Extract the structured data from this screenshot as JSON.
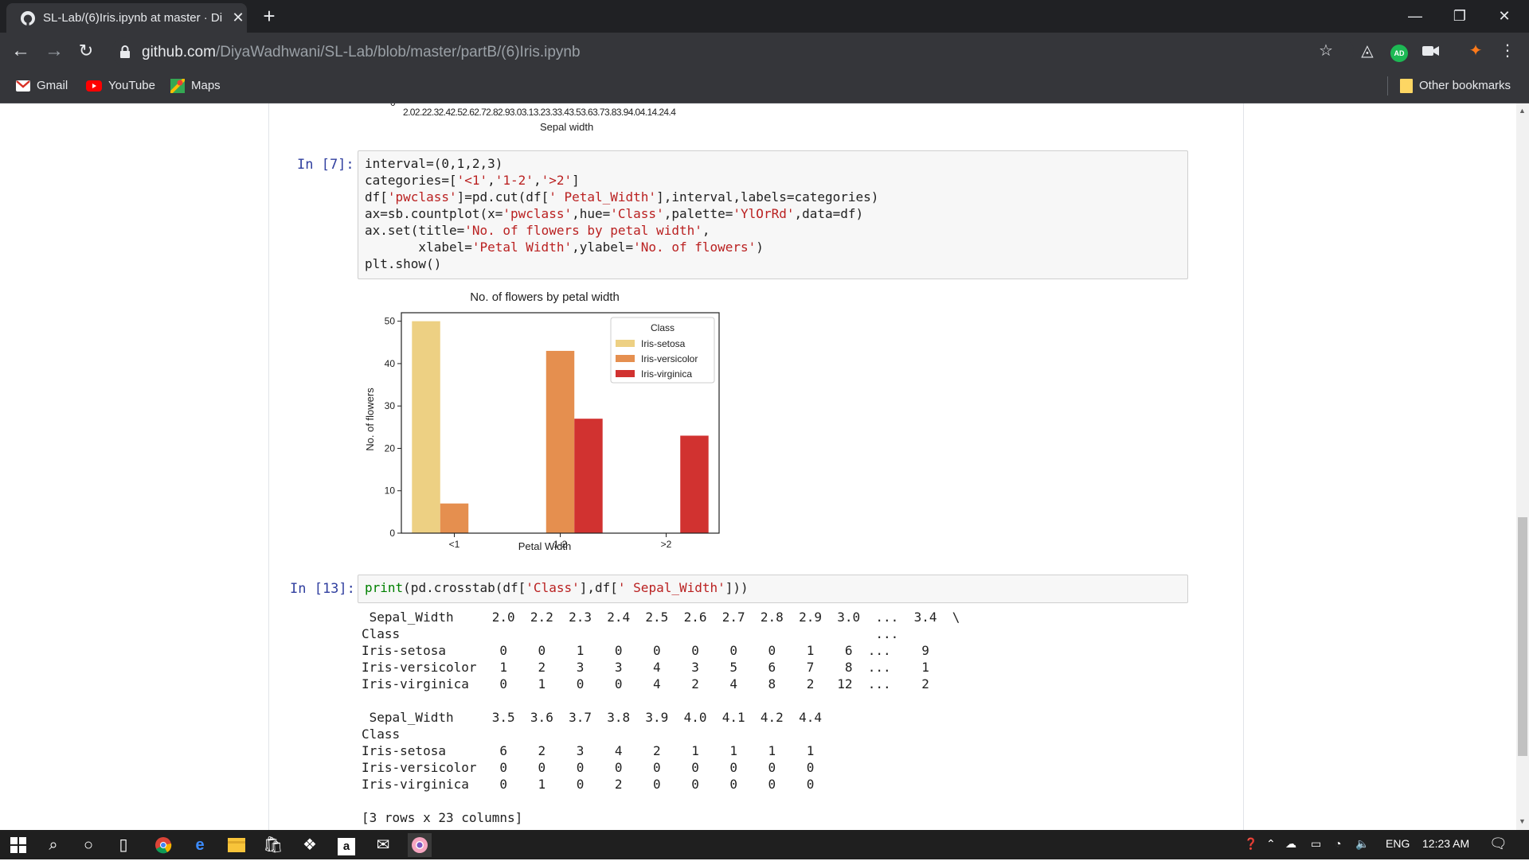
{
  "browser": {
    "tab_title": "SL-Lab/(6)Iris.ipynb at master · Di",
    "url_host": "github.com",
    "url_path": "/DiyaWadhwani/SL-Lab/blob/master/partB/(6)Iris.ipynb",
    "profile_badge": "AD",
    "bookmarks": [
      {
        "label": "Gmail",
        "icon": "gmail-icon"
      },
      {
        "label": "YouTube",
        "icon": "youtube-icon"
      },
      {
        "label": "Maps",
        "icon": "maps-icon"
      }
    ],
    "other_bookmarks": "Other bookmarks"
  },
  "prev_chart": {
    "tick_zero": "0",
    "xticks": "2.02.22.32.42.52.62.72.82.93.03.13.23.33.43.53.63.73.83.94.04.14.24.4",
    "xlabel": "Sepal width"
  },
  "cell7": {
    "prompt": "In [7]:",
    "lines": [
      "interval=(0,1,2,3)",
      "categories=['<1','1-2','>2']",
      "df['pwclass']=pd.cut(df[' Petal_Width'],interval,labels=categories)",
      "ax=sb.countplot(x='pwclass',hue='Class',palette='YlOrRd',data=df)",
      "ax.set(title='No. of flowers by petal width',",
      "       xlabel='Petal Width',ylabel='No. of flowers')",
      "plt.show()"
    ]
  },
  "chart_data": {
    "type": "bar",
    "title": "No. of flowers by petal width",
    "xlabel": "Petal Width",
    "ylabel": "No. of flowers",
    "categories": [
      "<1",
      "1-2",
      ">2"
    ],
    "ylim": [
      0,
      52
    ],
    "yticks": [
      0,
      10,
      20,
      30,
      40,
      50
    ],
    "legend_title": "Class",
    "legend_position": "top-right",
    "grid": false,
    "series": [
      {
        "name": "Iris-setosa",
        "color": "#edd083",
        "values": [
          50,
          0,
          0
        ]
      },
      {
        "name": "Iris-versicolor",
        "color": "#e58f4f",
        "values": [
          7,
          43,
          0
        ]
      },
      {
        "name": "Iris-virginica",
        "color": "#d13230",
        "values": [
          0,
          27,
          23
        ]
      }
    ]
  },
  "cell13": {
    "prompt": "In [13]:",
    "code_fn": "print",
    "code_mid1": "(pd.crosstab(df[",
    "code_str1": "'Class'",
    "code_mid2": "],df[",
    "code_str2": "' Sepal_Width'",
    "code_end": "]))",
    "output_lines": [
      " Sepal_Width     2.0  2.2  2.3  2.4  2.5  2.6  2.7  2.8  2.9  3.0  ...  3.4  \\",
      "Class                                                              ...       ",
      "Iris-setosa       0    0    1    0    0    0    0    0    1    6  ...    9   ",
      "Iris-versicolor   1    2    3    3    4    3    5    6    7    8  ...    1   ",
      "Iris-virginica    0    1    0    0    4    2    4    8    2   12  ...    2   ",
      "",
      " Sepal_Width     3.5  3.6  3.7  3.8  3.9  4.0  4.1  4.2  4.4  ",
      "Class                                                         ",
      "Iris-setosa       6    2    3    4    2    1    1    1    1  ",
      "Iris-versicolor   0    0    0    0    0    0    0    0    0  ",
      "Iris-virginica    0    1    0    2    0    0    0    0    0  ",
      "",
      "[3 rows x 23 columns]"
    ]
  },
  "taskbar": {
    "lang": "ENG",
    "time": "12:23 AM"
  }
}
